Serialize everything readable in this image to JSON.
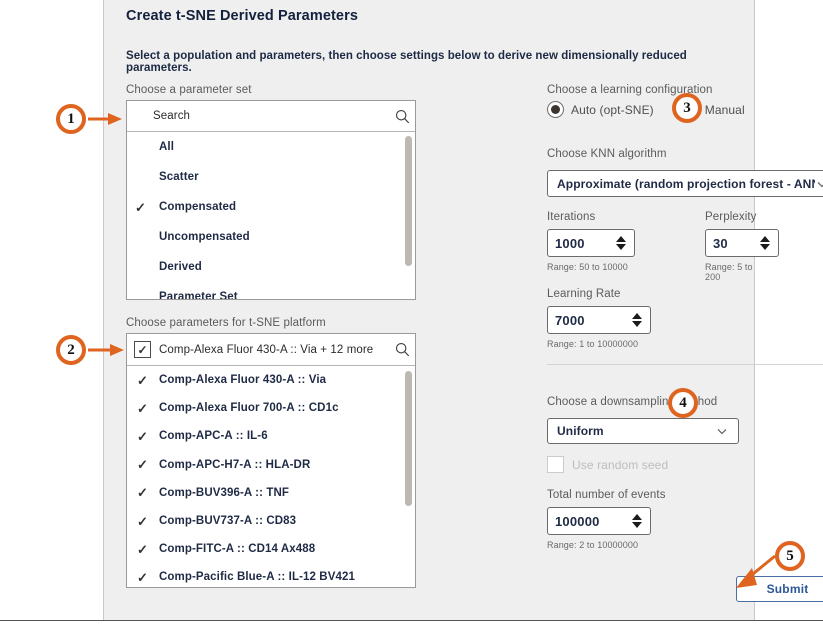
{
  "dialog": {
    "title": "Create t-SNE Derived Parameters",
    "subtitle": "Select a population and parameters, then choose settings below to derive new dimensionally reduced parameters."
  },
  "parameter_set": {
    "label": "Choose a parameter set",
    "search_placeholder": "Search",
    "search_icon": "search-icon",
    "items": [
      {
        "label": "All",
        "checked": false
      },
      {
        "label": "Scatter",
        "checked": false
      },
      {
        "label": "Compensated",
        "checked": true
      },
      {
        "label": "Uncompensated",
        "checked": false
      },
      {
        "label": "Derived",
        "checked": false
      },
      {
        "label": "Parameter Set",
        "checked": false
      }
    ]
  },
  "parameters": {
    "label": "Choose parameters for t-SNE platform",
    "summary": "Comp-Alexa Fluor 430-A :: Via + 12 more",
    "summary_checked": true,
    "search_icon": "search-icon",
    "items": [
      {
        "label": "Comp-Alexa Fluor 430-A :: Via",
        "checked": true
      },
      {
        "label": "Comp-Alexa Fluor 700-A :: CD1c",
        "checked": true
      },
      {
        "label": "Comp-APC-A :: IL-6",
        "checked": true
      },
      {
        "label": "Comp-APC-H7-A :: HLA-DR",
        "checked": true
      },
      {
        "label": "Comp-BUV396-A :: TNF",
        "checked": true
      },
      {
        "label": "Comp-BUV737-A :: CD83",
        "checked": true
      },
      {
        "label": "Comp-FITC-A :: CD14 Ax488",
        "checked": true
      },
      {
        "label": "Comp-Pacific Blue-A :: IL-12 BV421",
        "checked": true
      }
    ]
  },
  "learning_config": {
    "label": "Choose a learning configuration",
    "options": [
      {
        "label": "Auto (opt-SNE)",
        "selected": true
      },
      {
        "label": "Manual",
        "selected": false
      }
    ]
  },
  "knn": {
    "label": "Choose KNN algorithm",
    "value": "Approximate (random projection forest - ANNOY)",
    "chevron_icon": "chevron-down-icon"
  },
  "iterations": {
    "label": "Iterations",
    "value": "1000",
    "range_hint": "Range: 50 to 10000"
  },
  "perplexity": {
    "label": "Perplexity",
    "value": "30",
    "range_hint": "Range: 5 to 200"
  },
  "learning_rate": {
    "label": "Learning Rate",
    "value": "7000",
    "range_hint": "Range: 1 to 10000000"
  },
  "downsampling": {
    "label": "Choose a downsampling method",
    "value": "Uniform",
    "chevron_icon": "chevron-down-icon",
    "random_seed_label": "Use random seed",
    "random_seed_checked": false
  },
  "total_events": {
    "label": "Total number of events",
    "value": "100000",
    "range_hint": "Range: 2 to 10000000"
  },
  "submit": {
    "label": "Submit"
  },
  "callouts": [
    {
      "number": "1"
    },
    {
      "number": "2"
    },
    {
      "number": "3"
    },
    {
      "number": "4"
    },
    {
      "number": "5"
    }
  ],
  "colors": {
    "callout": "#de6420",
    "panel_bg": "#efefef",
    "heading": "#14213d",
    "submit_border": "#4a6fa5",
    "submit_text": "#2b5797"
  }
}
